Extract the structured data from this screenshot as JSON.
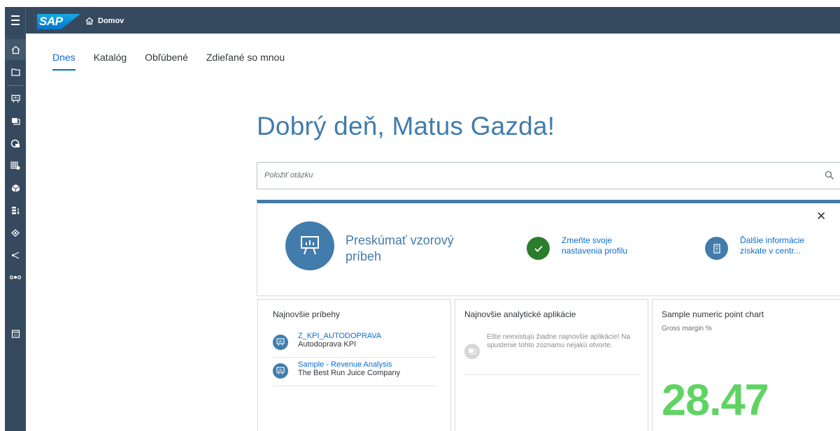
{
  "shell": {
    "logo_text": "SAP",
    "home_label": "Domov",
    "brand_color": "#354a5f"
  },
  "sidenav": {
    "icons": [
      "home-icon",
      "folder-icon",
      "presentation-icon",
      "analytic-app-icon",
      "dashboard-icon",
      "data-table-icon",
      "model-cube-icon",
      "sort-icon",
      "connection-icon",
      "share-icon",
      "workflow-icon",
      "calendar-icon"
    ]
  },
  "tabs": [
    {
      "label": "Dnes",
      "active": true
    },
    {
      "label": "Katalóg",
      "active": false
    },
    {
      "label": "Obľúbené",
      "active": false
    },
    {
      "label": "Zdieľané so mnou",
      "active": false
    }
  ],
  "greeting": "Dobrý deň, Matus Gazda!",
  "search": {
    "placeholder": "Položiť otázku"
  },
  "welcome": {
    "primary_action": "Preskúmať vzorový príbeh",
    "profile_action": "Zmeňte svoje nastavenia profilu",
    "info_action": "Ďalšie informácie získate v centr..."
  },
  "tiles": {
    "stories": {
      "title": "Najnovšie príbehy",
      "items": [
        {
          "title": "Z_KPI_AUTODOPRAVA",
          "subtitle": "Autodoprava KPI"
        },
        {
          "title": "Sample - Revenue Analysis",
          "subtitle": "The Best Run Juice Company"
        }
      ]
    },
    "apps": {
      "title": "Najnovšie analytické aplikácie",
      "empty_text": "Ešte neexistujú žiadne najnovšie aplikácie! Na spustenie tohto zoznamu nejakú otvorte."
    },
    "kpi": {
      "title": "Sample numeric point chart",
      "subtitle": "Gross margin %",
      "value": "28.47",
      "value_color": "#5fd463"
    }
  }
}
